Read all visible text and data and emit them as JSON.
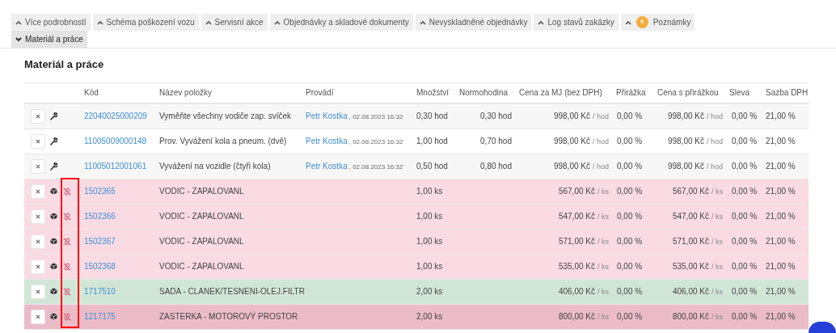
{
  "tabs": [
    {
      "label": "Více podrobností",
      "expanded": false
    },
    {
      "label": "Schéma poškození vozu",
      "expanded": false
    },
    {
      "label": "Servisní akce",
      "expanded": false
    },
    {
      "label": "Objednávky a skladové dokumenty",
      "expanded": false
    },
    {
      "label": "Nevyskladněné objednávky",
      "expanded": false
    },
    {
      "label": "Log stavů zakázky",
      "expanded": false
    },
    {
      "label": "Poznámky",
      "expanded": false,
      "badge": "0"
    },
    {
      "label": "Materiál a práce",
      "expanded": true
    }
  ],
  "section_title": "Materiál a práce",
  "highlight_unlink_column": true,
  "table": {
    "columns": [
      "Kód",
      "Název položky",
      "Provádí",
      "Množství",
      "Normohodina",
      "Cena za MJ (bez DPH)",
      "Přirážka",
      "Cena s přirážkou",
      "Sleva",
      "Sazba DPH"
    ],
    "rows": [
      {
        "kind": "work",
        "code": "22040025000209",
        "name": "Vyměňte všechny vodiče zap. svíček",
        "performer": "Petr Kostka",
        "timestamp": ", 02.08.2023 16:32",
        "quantity": "0,30 hod",
        "norm_hours": "0,30 hod",
        "unit_price": "998,00 Kč",
        "unit_price_unit": "/ hod",
        "markup": "0,00 %",
        "price_with_markup": "998,00 Kč",
        "price_with_markup_unit": "/ hod",
        "discount": "0,00 %",
        "vat_rate": "21,00 %"
      },
      {
        "kind": "work",
        "code": "11005009000148",
        "name": "Prov. Vyvážení kola a pneum. (dvě)",
        "performer": "Petr Kostka",
        "timestamp": ", 02.08.2023 16:32",
        "quantity": "1,00 hod",
        "norm_hours": "0,70 hod",
        "unit_price": "998,00 Kč",
        "unit_price_unit": "/ hod",
        "markup": "0,00 %",
        "price_with_markup": "998,00 Kč",
        "price_with_markup_unit": "/ hod",
        "discount": "0,00 %",
        "vat_rate": "21,00 %"
      },
      {
        "kind": "work",
        "code": "11005012001061",
        "name": "Vyvážení na vozidle (čtyři kola)",
        "performer": "Petr Kostka",
        "timestamp": ", 02.08.2023 16:32",
        "quantity": "0,50 hod",
        "norm_hours": "0,80 hod",
        "unit_price": "998,00 Kč",
        "unit_price_unit": "/ hod",
        "markup": "0,00 %",
        "price_with_markup": "998,00 Kč",
        "price_with_markup_unit": "/ hod",
        "discount": "0,00 %",
        "vat_rate": "21,00 %"
      },
      {
        "kind": "part",
        "color": "#fadbe3",
        "code": "1502365",
        "name": "VODIC - ZAPALOVANL",
        "quantity": "1,00 ks",
        "unit_price": "567,00 Kč",
        "unit_price_unit": "/ ks",
        "markup": "0,00 %",
        "price_with_markup": "567,00 Kč",
        "price_with_markup_unit": "/ ks",
        "discount": "0,00 %",
        "vat_rate": "21,00 %"
      },
      {
        "kind": "part",
        "color": "#fadbe3",
        "code": "1502366",
        "name": "VODIC - ZAPALOVANL",
        "quantity": "1,00 ks",
        "unit_price": "547,00 Kč",
        "unit_price_unit": "/ ks",
        "markup": "0,00 %",
        "price_with_markup": "547,00 Kč",
        "price_with_markup_unit": "/ ks",
        "discount": "0,00 %",
        "vat_rate": "21,00 %"
      },
      {
        "kind": "part",
        "color": "#fadbe3",
        "code": "1502367",
        "name": "VODIC - ZAPALOVANL",
        "quantity": "1,00 ks",
        "unit_price": "571,00 Kč",
        "unit_price_unit": "/ ks",
        "markup": "0,00 %",
        "price_with_markup": "571,00 Kč",
        "price_with_markup_unit": "/ ks",
        "discount": "0,00 %",
        "vat_rate": "21,00 %"
      },
      {
        "kind": "part",
        "color": "#fadbe3",
        "code": "1502368",
        "name": "VODIC - ZAPALOVANL",
        "quantity": "1,00 ks",
        "unit_price": "535,00 Kč",
        "unit_price_unit": "/ ks",
        "markup": "0,00 %",
        "price_with_markup": "535,00 Kč",
        "price_with_markup_unit": "/ ks",
        "discount": "0,00 %",
        "vat_rate": "21,00 %"
      },
      {
        "kind": "part",
        "color": "#d2e6d8",
        "code": "1717510",
        "name": "SADA - CLANEK/TESNENI-OLEJ.FILTR",
        "quantity": "2,00 ks",
        "unit_price": "406,00 Kč",
        "unit_price_unit": "/ ks",
        "markup": "0,00 %",
        "price_with_markup": "406,00 Kč",
        "price_with_markup_unit": "/ ks",
        "discount": "0,00 %",
        "vat_rate": "21,00 %"
      },
      {
        "kind": "part",
        "color": "#ebbcc8",
        "code": "1217175",
        "name": "ZASTERKA - MOTOROVÝ PROSTOR",
        "quantity": "2,00 ks",
        "unit_price": "800,00 Kč",
        "unit_price_unit": "/ ks",
        "markup": "0,00 %",
        "price_with_markup": "800,00 Kč",
        "price_with_markup_unit": "/ ks",
        "discount": "0,00 %",
        "vat_rate": "21,00 %"
      }
    ]
  }
}
